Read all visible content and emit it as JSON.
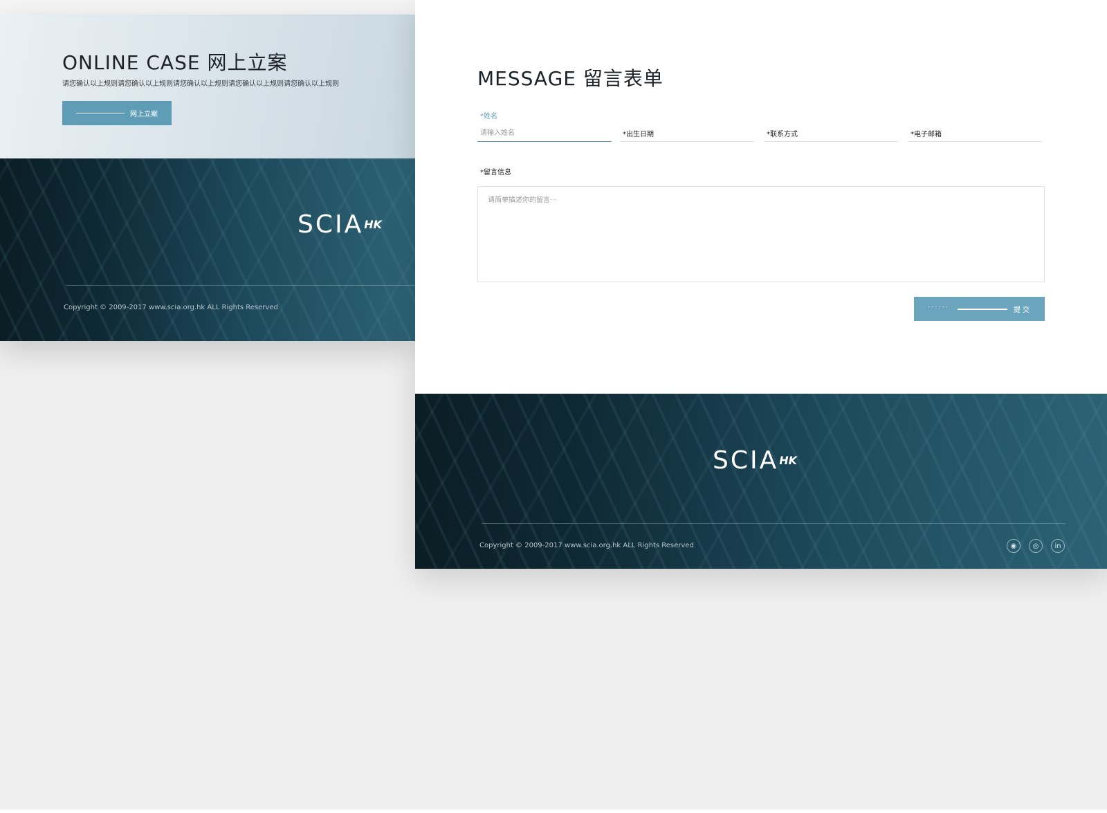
{
  "left_panel": {
    "title": "ONLINE CASE 网上立案",
    "subtitle": "请您确认以上规则请您确认以上规则请您确认以上规则请您确认以上规则请您确认以上规则",
    "button_label": "网上立案"
  },
  "form": {
    "title": "MESSAGE 留言表单",
    "fields": [
      {
        "label": "*姓名",
        "placeholder": "请输入姓名",
        "value": ""
      },
      {
        "label": "*出生日期",
        "placeholder": "",
        "value": ""
      },
      {
        "label": "*联系方式",
        "placeholder": "",
        "value": ""
      },
      {
        "label": "*电子邮箱",
        "placeholder": "",
        "value": ""
      }
    ],
    "message_label": "*留言信息",
    "message_placeholder": "请简单描述你的留言···",
    "submit_dots": "······",
    "submit_label": "提交"
  },
  "footer": {
    "logo_main": "SCIA",
    "logo_suffix": "HK",
    "copyright": "Copyright © 2009-2017 www.scia.org.hk ALL Rights Reserved",
    "social_icons": [
      "wechat-icon",
      "weibo-icon",
      "linkedin-icon"
    ],
    "social_glyphs": [
      "◉",
      "◎",
      "in"
    ]
  },
  "colors": {
    "accent": "#5f9cb6",
    "footer_dark": "#0b1d24",
    "footer_teal": "#2d6275",
    "page_background": "#efefef"
  }
}
